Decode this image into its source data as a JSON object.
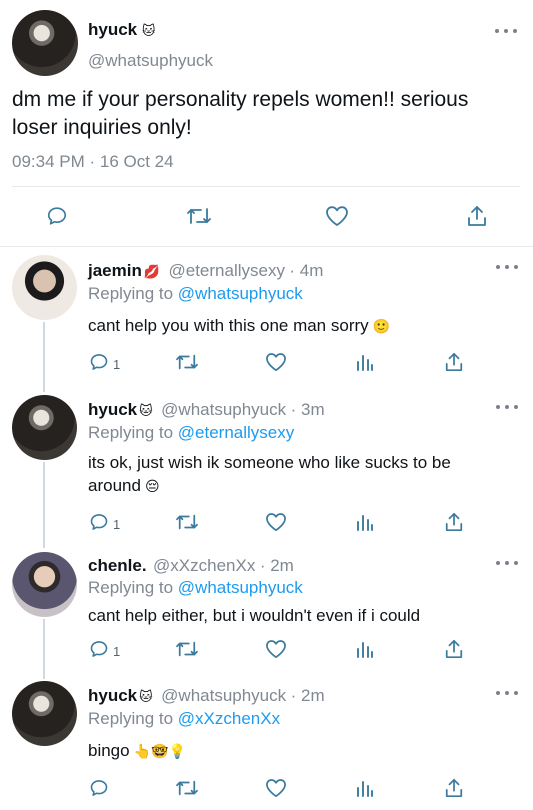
{
  "main_tweet": {
    "name": "hyuck",
    "name_emoji": "🐱",
    "handle": "@whatsuphyuck",
    "text": "dm me if your personality repels women!! serious loser inquiries only!",
    "timestamp": "09:34 PM · 16 Oct 24"
  },
  "replies": [
    {
      "name": "jaemin",
      "name_emoji": "💋",
      "handle": "@eternallysexy",
      "time": "· 4m",
      "replying_prefix": "Replying to",
      "replying_to": "@whatsuphyuck",
      "text": "cant help you with this one man sorry",
      "text_emoji": "🙂",
      "reply_count": "1"
    },
    {
      "name": "hyuck",
      "name_emoji": "🐱",
      "handle": "@whatsuphyuck",
      "time": "· 3m",
      "replying_prefix": "Replying to",
      "replying_to": "@eternallysexy",
      "text_line1": "its ok, just wish ik someone who like sucks to be",
      "text_line2": "around",
      "text_emoji": "😔",
      "reply_count": "1"
    },
    {
      "name": "chenle.",
      "handle": "@xXzchenXx",
      "time": "· 2m",
      "replying_prefix": "Replying to",
      "replying_to": "@whatsuphyuck",
      "text": "cant help either, but i wouldn't even if i could",
      "reply_count": "1"
    },
    {
      "name": "hyuck",
      "name_emoji": "🐱",
      "handle": "@whatsuphyuck",
      "time": "· 2m",
      "replying_prefix": "Replying to",
      "replying_to": "@xXzchenXx",
      "text": "bingo",
      "text_emojis": "👆🤓💡"
    }
  ],
  "colors": {
    "link": "#1d9bf0",
    "muted": "#808891",
    "icon": "#3a7a9c"
  },
  "icons": [
    "reply-icon",
    "retweet-icon",
    "like-icon",
    "views-icon",
    "share-icon",
    "more-icon"
  ]
}
